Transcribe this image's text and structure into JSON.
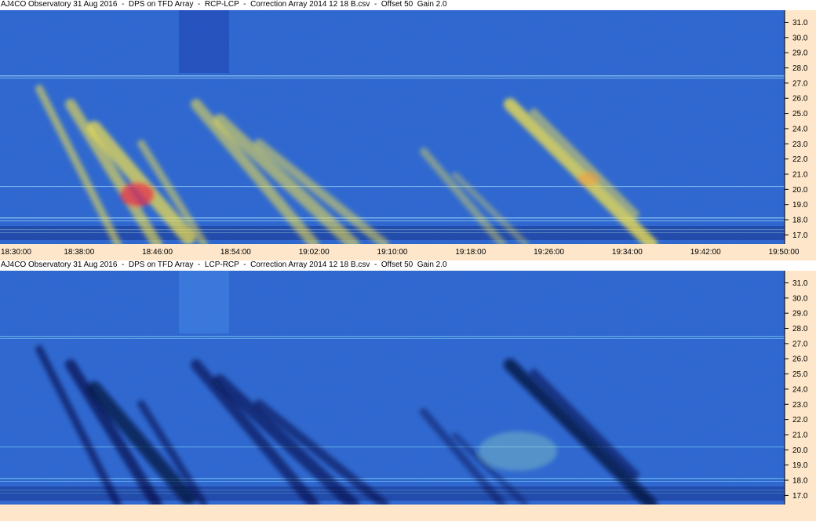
{
  "chart_data": [
    {
      "type": "heatmap",
      "title": "AJ4CO Observatory 31 Aug 2016  -  DPS on TFD Array  -  RCP-LCP  -  Correction Array 2014 12 18 B.csv  -  Offset 50  Gain 2.0",
      "x_ticks": [
        "18:30:00",
        "18:38:00",
        "18:46:00",
        "18:54:00",
        "19:02:00",
        "19:10:00",
        "19:18:00",
        "19:26:00",
        "19:34:00",
        "19:42:00",
        "19:50:00"
      ],
      "y_ticks": [
        "31.0",
        "30.0",
        "29.0",
        "28.0",
        "27.0",
        "26.0",
        "25.0",
        "24.0",
        "23.0",
        "22.0",
        "21.0",
        "20.0",
        "19.0",
        "18.0",
        "17.0"
      ],
      "x_range": [
        "18:30:00",
        "19:50:00"
      ],
      "y_range": [
        16.4,
        31.8
      ],
      "polarity": "positive",
      "colors": {
        "background": "#2f6fe0",
        "enhanced": "#f6e34a",
        "peak": "#e8334b",
        "depleted": "#0c1a6e"
      }
    },
    {
      "type": "heatmap",
      "title": "AJ4CO Observatory 31 Aug 2016  -  DPS on TFD Array  -  LCP-RCP  -  Correction Array 2014 12 18 B.csv  -  Offset 50  Gain 2.0",
      "x_ticks": [],
      "y_ticks": [
        "31.0",
        "30.0",
        "29.0",
        "28.0",
        "27.0",
        "26.0",
        "25.0",
        "24.0",
        "23.0",
        "22.0",
        "21.0",
        "20.0",
        "19.0",
        "18.0",
        "17.0"
      ],
      "x_range": [
        "18:30:00",
        "19:50:00"
      ],
      "y_range": [
        16.4,
        31.8
      ],
      "polarity": "negative",
      "colors": {
        "background": "#2f6fe0",
        "enhanced": "#4fc7e6",
        "peak": "#9be0c0",
        "depleted": "#050a3a"
      }
    }
  ]
}
